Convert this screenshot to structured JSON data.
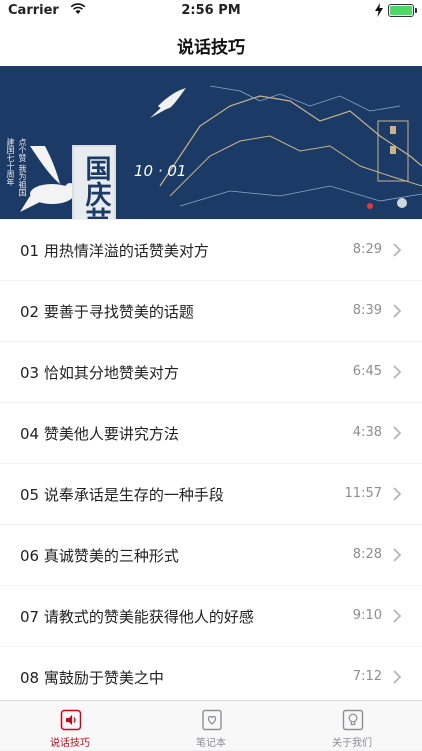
{
  "status": {
    "carrier": "Carrier",
    "time": "2:56 PM",
    "battery_level": 1.0
  },
  "nav": {
    "title": "说话技巧"
  },
  "banner": {
    "badge_text": "国庆节",
    "date_text": "10 · 01",
    "vertical_text": "点个赞 我为祖国 建国七十周年"
  },
  "lessons": [
    {
      "title": "01 用热情洋溢的话赞美对方",
      "duration": "8:29"
    },
    {
      "title": "02 要善于寻找赞美的话题",
      "duration": "8:39"
    },
    {
      "title": "03 恰如其分地赞美对方",
      "duration": "6:45"
    },
    {
      "title": "04 赞美他人要讲究方法",
      "duration": "4:38"
    },
    {
      "title": "05 说奉承话是生存的一种手段",
      "duration": "11:57"
    },
    {
      "title": "06 真诚赞美的三种形式",
      "duration": "8:28"
    },
    {
      "title": "07 请教式的赞美能获得他人的好感",
      "duration": "9:10"
    },
    {
      "title": "08 寓鼓励于赞美之中",
      "duration": "7:12"
    }
  ],
  "tabs": [
    {
      "label": "说话技巧",
      "icon": "speaker-icon",
      "active": true
    },
    {
      "label": "笔记本",
      "icon": "notebook-heart-icon",
      "active": false
    },
    {
      "label": "关于我们",
      "icon": "lightbulb-icon",
      "active": false
    }
  ],
  "colors": {
    "accent": "#d0021b",
    "banner_bg": "#1b3a66",
    "battery": "#4cd964"
  }
}
